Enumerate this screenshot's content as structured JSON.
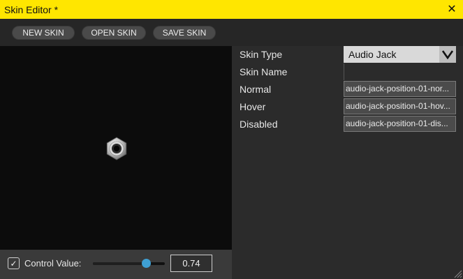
{
  "window": {
    "title": "Skin Editor *",
    "close_icon": "close-icon"
  },
  "toolbar": {
    "new_label": "NEW SKIN",
    "open_label": "OPEN SKIN",
    "save_label": "SAVE SKIN"
  },
  "preview": {
    "icon": "audio-jack-icon"
  },
  "control": {
    "checked": true,
    "label": "Control Value:",
    "value_text": "0.74",
    "slider_fraction": 0.74
  },
  "properties": {
    "skin_type": {
      "label": "Skin Type",
      "value": "Audio Jack"
    },
    "skin_name": {
      "label": "Skin Name",
      "value": ""
    },
    "normal": {
      "label": "Normal",
      "value": "audio-jack-position-01-nor..."
    },
    "hover": {
      "label": "Hover",
      "value": "audio-jack-position-01-hov..."
    },
    "disabled": {
      "label": "Disabled",
      "value": "audio-jack-position-01-dis..."
    }
  },
  "colors": {
    "accent": "#ffe600",
    "slider_thumb": "#3fa0d4"
  }
}
